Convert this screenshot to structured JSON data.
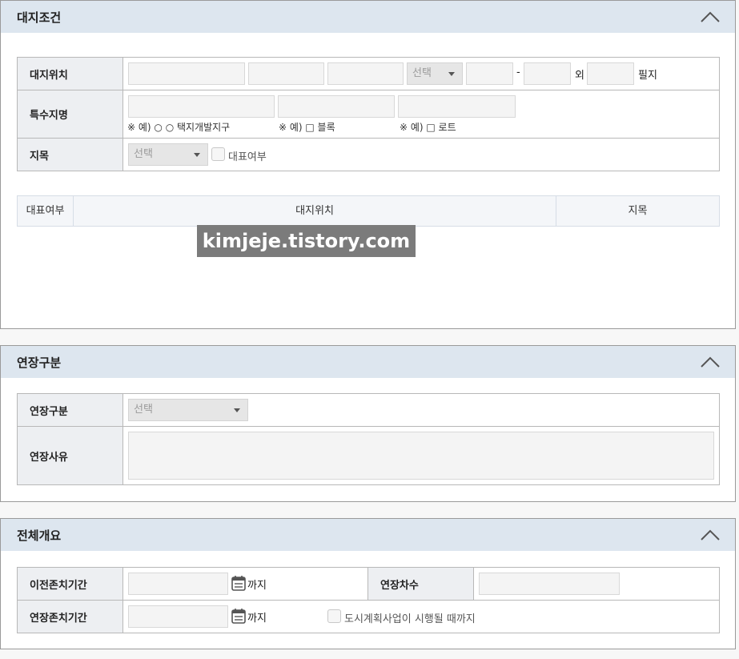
{
  "sections": {
    "site": {
      "title": "대지조건",
      "location": {
        "label": "대지위치",
        "select_value": "선택",
        "dash": "-",
        "outside": "외",
        "lot_unit": "필지"
      },
      "special_name": {
        "label": "특수지명",
        "hint1": "※ 예) ○ ○ 택지개발지구",
        "hint2": "※ 예) □ 블록",
        "hint3": "※ 예) □ 로트"
      },
      "land_category": {
        "label": "지목",
        "select_value": "선택",
        "checkbox_label": "대표여부"
      },
      "list": {
        "columns": [
          "대표여부",
          "대지위치",
          "지목"
        ]
      }
    },
    "extension": {
      "title": "연장구분",
      "type": {
        "label": "연장구분",
        "select_value": "선택"
      },
      "reason": {
        "label": "연장사유"
      }
    },
    "overview": {
      "title": "전체개요",
      "prev_period": {
        "label": "이전존치기간",
        "until": "까지"
      },
      "ext_count": {
        "label": "연장차수"
      },
      "ext_period": {
        "label": "연장존치기간",
        "until": "까지",
        "checkbox_label": "도시계획사업이 시행될 때까지"
      }
    }
  },
  "watermark": "kimjeje.tistory.com"
}
